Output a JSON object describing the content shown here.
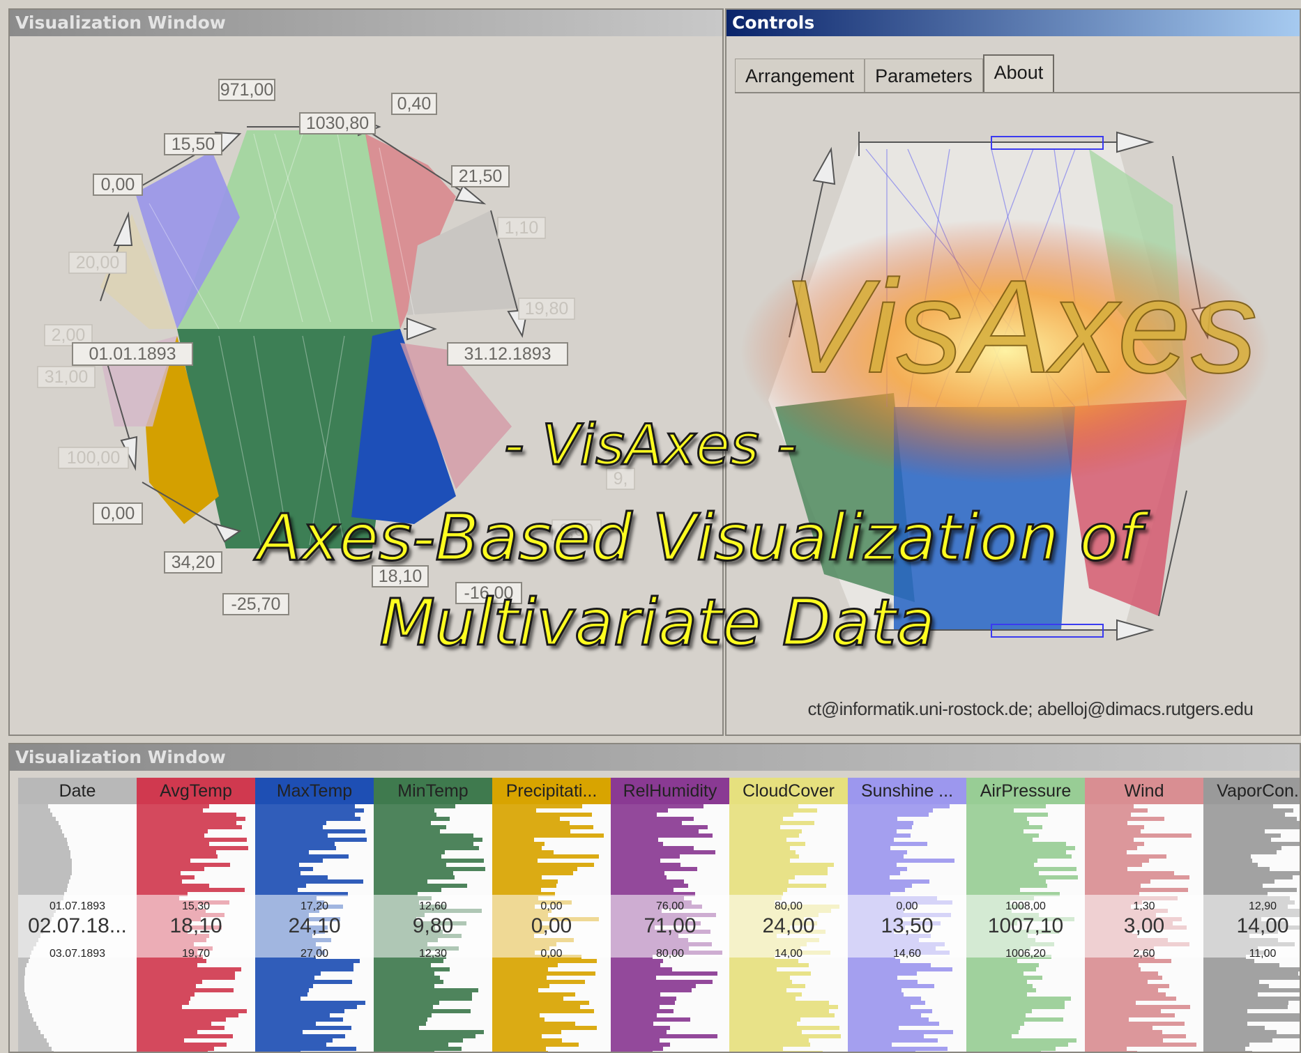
{
  "top_window": {
    "title": "Visualization Window",
    "labels": [
      "971,00",
      "1030,80",
      "0,40",
      "15,50",
      "21,50",
      "0,00",
      "1,10",
      "20,00",
      "19,80",
      "2,00",
      "01.01.1893",
      "31.12.1893",
      "31,00",
      "100,00",
      "0,00",
      "34,20",
      "-25,70",
      "18,10",
      "-16,00",
      "0,00",
      "9,"
    ]
  },
  "controls": {
    "title": "Controls",
    "tabs": [
      {
        "label": "Arrangement",
        "active": false
      },
      {
        "label": "Parameters",
        "active": false
      },
      {
        "label": "About",
        "active": true
      }
    ],
    "logo_text": "VisAxes",
    "contact": "ct@informatik.uni-rostock.de;  abelloj@dimacs.rutgers.edu"
  },
  "bottom_window": {
    "title": "Visualization Window",
    "columns": [
      {
        "name": "Date",
        "color": "#b8b8b8",
        "current": "02.07.18...",
        "near": [
          "01.07.1893",
          "03.07.1893"
        ]
      },
      {
        "name": "AvgTemp",
        "color": "#d0394f",
        "current": "18,10",
        "near": [
          "15,30",
          "19,70"
        ]
      },
      {
        "name": "MaxTemp",
        "color": "#1e4fb4",
        "current": "24,10",
        "near": [
          "17,20",
          "27,00"
        ]
      },
      {
        "name": "MinTemp",
        "color": "#3f7a4e",
        "current": "9,80",
        "near": [
          "12,60",
          "12,30"
        ]
      },
      {
        "name": "Precipitati...",
        "color": "#d8a400",
        "current": "0,00",
        "near": [
          "0,00",
          "0,00"
        ]
      },
      {
        "name": "RelHumidity",
        "color": "#8a3a93",
        "current": "71,00",
        "near": [
          "76,00",
          "80,00"
        ]
      },
      {
        "name": "CloudCover",
        "color": "#e6e07e",
        "current": "24,00",
        "near": [
          "80,00",
          "14,00"
        ]
      },
      {
        "name": "Sunshine ...",
        "color": "#9c97ee",
        "current": "13,50",
        "near": [
          "0,00",
          "14,60"
        ]
      },
      {
        "name": "AirPressure",
        "color": "#98cd95",
        "current": "1007,10",
        "near": [
          "1008,00",
          "1006,20"
        ]
      },
      {
        "name": "Wind",
        "color": "#d98e92",
        "current": "3,00",
        "near": [
          "1,30",
          "2,60"
        ]
      },
      {
        "name": "VaporCon...",
        "color": "#9a9a9a",
        "current": "14,00",
        "near": [
          "12,90",
          "11,00"
        ]
      }
    ]
  },
  "overlay_title": {
    "line1": "- VisAxes -",
    "line2": "Axes-Based Visualization of",
    "line3": "Multivariate Data"
  },
  "colors": {
    "title_text": "#ffff20",
    "active_titlebar": "#0a246a",
    "panel_bg": "#d6d2cc"
  }
}
